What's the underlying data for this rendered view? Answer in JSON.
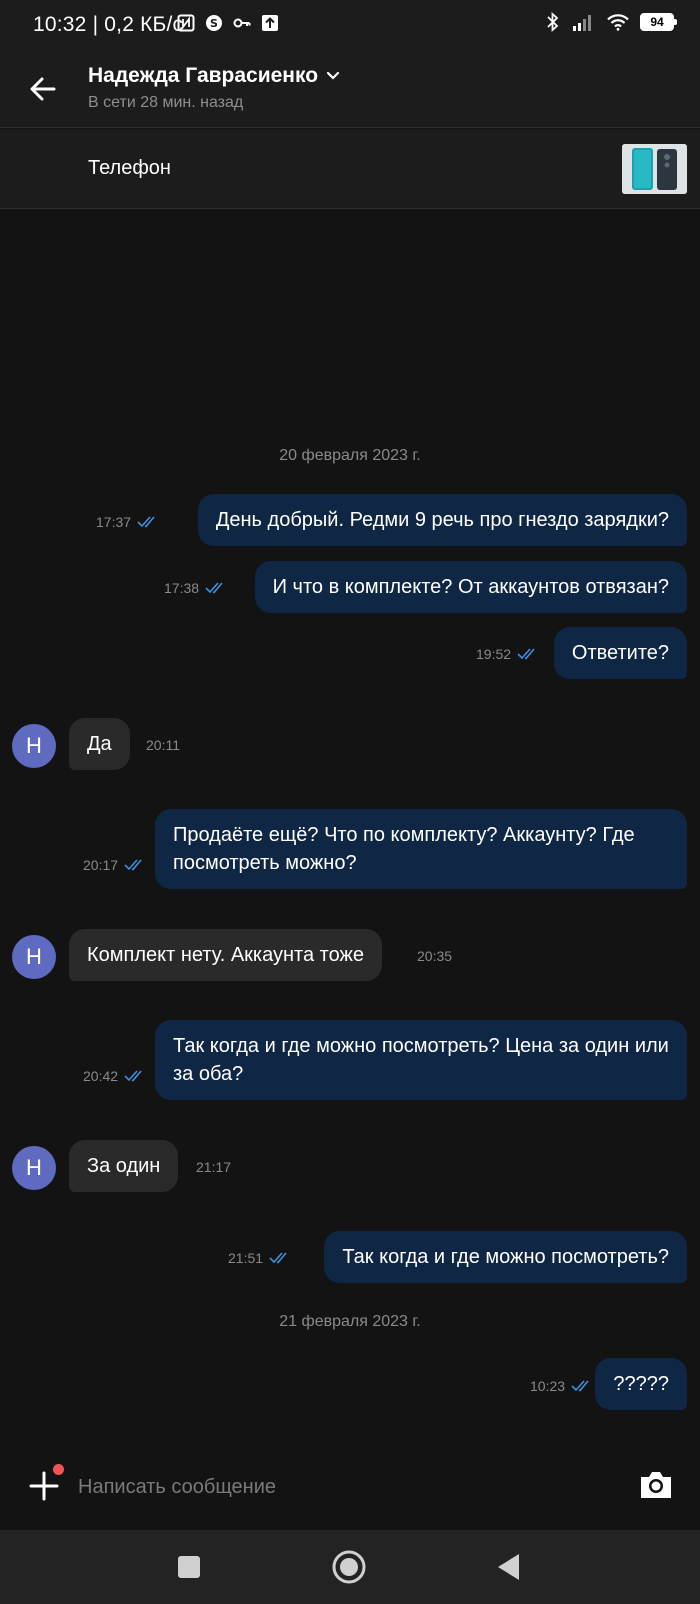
{
  "status_bar": {
    "time": "10:32 | 0,2 КБ/с",
    "battery": "94"
  },
  "header": {
    "contact_name": "Надежда Гаврасиенко",
    "contact_status": "В сети 28 мин. назад"
  },
  "product": {
    "title": "Телефон"
  },
  "dates": [
    "20 февраля 2023 г.",
    "21 февраля 2023 г."
  ],
  "messages": [
    {
      "dir": "out",
      "text": "День добрый. Редми 9 речь про гнездо зарядки?",
      "time": "17:37"
    },
    {
      "dir": "out",
      "text": "И что в комплекте? От аккаунтов отвязан?",
      "time": "17:38"
    },
    {
      "dir": "out",
      "text": "Ответите?",
      "time": "19:52"
    },
    {
      "dir": "in",
      "text": "Да",
      "time": "20:11",
      "avatar": "Н"
    },
    {
      "dir": "out",
      "text": "Продаёте ещё? Что по комплекту? Аккаунту? Где посмотреть можно?",
      "time": "20:17"
    },
    {
      "dir": "in",
      "text": "Комплект нету. Аккаунта тоже",
      "time": "20:35",
      "avatar": "Н"
    },
    {
      "dir": "out",
      "text": "Так когда и где можно посмотреть? Цена за один или за оба?",
      "time": "20:42"
    },
    {
      "dir": "in",
      "text": "За один",
      "time": "21:17",
      "avatar": "Н"
    },
    {
      "dir": "out",
      "text": "Так когда и где можно посмотреть?",
      "time": "21:51"
    },
    {
      "dir": "out",
      "text": "?????",
      "time": "10:23"
    }
  ],
  "composer": {
    "placeholder": "Написать сообщение"
  },
  "colors": {
    "outgoing_bubble": "#0f2745",
    "incoming_bubble": "#2a2a2a",
    "avatar": "#5f6bc1",
    "read_ticks": "#3d8fe0",
    "notification_dot": "#f05454"
  }
}
